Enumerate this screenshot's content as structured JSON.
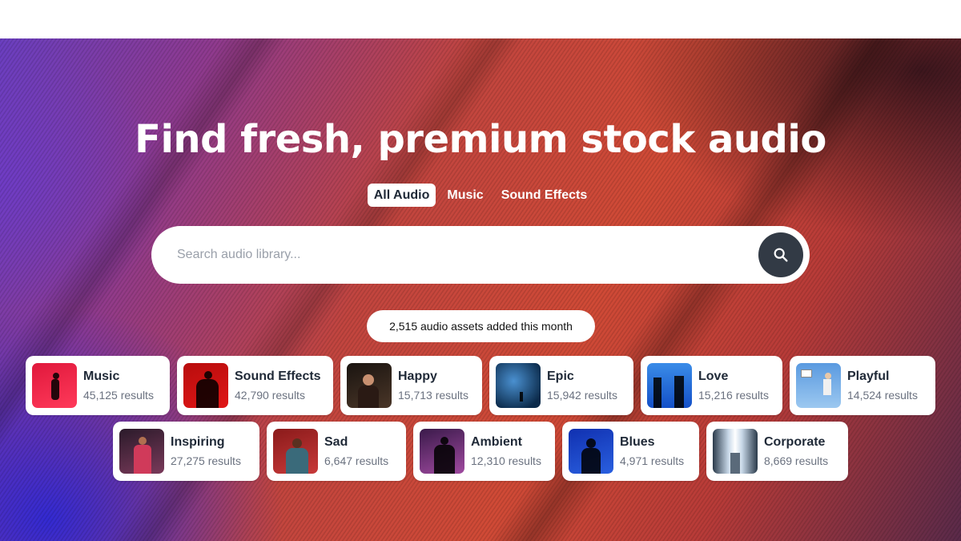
{
  "hero": {
    "title": "Find fresh, premium stock audio"
  },
  "tabs": [
    {
      "label": "All Audio",
      "active": true
    },
    {
      "label": "Music",
      "active": false
    },
    {
      "label": "Sound Effects",
      "active": false
    }
  ],
  "search": {
    "placeholder": "Search audio library...",
    "button_icon": "search-icon"
  },
  "stats": {
    "assets_text": "2,515 audio assets added this month"
  },
  "categories": [
    {
      "name": "Music",
      "count": "45,125 results",
      "thumb_colors": [
        "#e0183c",
        "#ff3a5a"
      ]
    },
    {
      "name": "Sound Effects",
      "count": "42,790 results",
      "thumb_colors": [
        "#b80d0d",
        "#e01616"
      ]
    },
    {
      "name": "Happy",
      "count": "15,713 results",
      "thumb_colors": [
        "#1a1410",
        "#4a3628"
      ]
    },
    {
      "name": "Epic",
      "count": "15,942 results",
      "thumb_colors": [
        "#0b2a4a",
        "#2f6fa8"
      ]
    },
    {
      "name": "Love",
      "count": "15,216 results",
      "thumb_colors": [
        "#1450c8",
        "#3a8ce8"
      ]
    },
    {
      "name": "Playful",
      "count": "14,524 results",
      "thumb_colors": [
        "#5a9ae0",
        "#9cc8f0"
      ]
    },
    {
      "name": "Inspiring",
      "count": "27,275 results",
      "thumb_colors": [
        "#2a1a2a",
        "#7a3a5a"
      ]
    },
    {
      "name": "Sad",
      "count": "6,647 results",
      "thumb_colors": [
        "#8a1a1a",
        "#c83a3a"
      ]
    },
    {
      "name": "Ambient",
      "count": "12,310 results",
      "thumb_colors": [
        "#3a1a4a",
        "#a04aa0"
      ]
    },
    {
      "name": "Blues",
      "count": "4,971 results",
      "thumb_colors": [
        "#1030b0",
        "#2a60e0"
      ]
    },
    {
      "name": "Corporate",
      "count": "8,669 results",
      "thumb_colors": [
        "#3a4a5a",
        "#c8d8e8"
      ]
    }
  ]
}
